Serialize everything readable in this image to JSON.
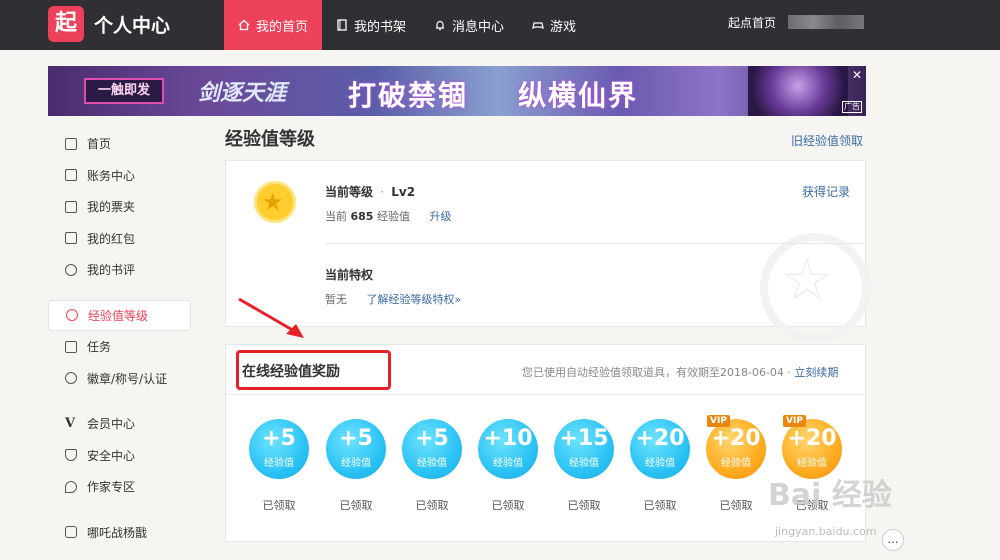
{
  "header": {
    "logo_char": "起",
    "brand": "个人中心",
    "nav": [
      {
        "label": "我的首页",
        "icon": "home-icon",
        "active": true
      },
      {
        "label": "我的书架",
        "icon": "book-icon",
        "active": false
      },
      {
        "label": "消息中心",
        "icon": "bell-icon",
        "active": false
      },
      {
        "label": "游戏",
        "icon": "gamepad-icon",
        "active": false
      }
    ],
    "right_link": "起点首页"
  },
  "banner": {
    "tag": "一触即发",
    "t1": "剑逐天涯",
    "t2": "打破禁锢",
    "t3": "纵横仙界",
    "ad": "广告",
    "close": "✕"
  },
  "sidebar": {
    "items": [
      {
        "label": "首页",
        "icon": "home-icon"
      },
      {
        "label": "账务中心",
        "icon": "document-icon"
      },
      {
        "label": "我的票夹",
        "icon": "ticket-icon"
      },
      {
        "label": "我的红包",
        "icon": "red-packet-icon"
      },
      {
        "label": "我的书评",
        "icon": "comment-icon"
      },
      {
        "label": "经验值等级",
        "icon": "level-icon",
        "active": true
      },
      {
        "label": "任务",
        "icon": "task-icon"
      },
      {
        "label": "徽章/称号/认证",
        "icon": "badge-icon"
      },
      {
        "label": "会员中心",
        "icon": "vip-icon"
      },
      {
        "label": "安全中心",
        "icon": "shield-icon"
      },
      {
        "label": "作家专区",
        "icon": "pen-icon"
      },
      {
        "label": "哪吒战杨戬",
        "icon": "gamepad-icon"
      }
    ]
  },
  "main": {
    "title": "经验值等级",
    "old_link": "旧经验值领取",
    "level": {
      "label": "当前等级",
      "dot": "·",
      "value": "Lv2",
      "current_prefix": "当前",
      "points": "685",
      "points_unit": "经验值",
      "upgrade": "升级",
      "record_link": "获得记录"
    },
    "privilege": {
      "label": "当前特权",
      "value": "暂无",
      "link": "了解经验等级特权»"
    },
    "online": {
      "title": "在线经验值奖励",
      "note": "您已使用自动经验值领取道具，有效期至2018-06-04 · ",
      "renew": "立刻续期",
      "rewards": [
        {
          "amount": "+5",
          "unit": "经验值",
          "status": "已领取",
          "vip": false
        },
        {
          "amount": "+5",
          "unit": "经验值",
          "status": "已领取",
          "vip": false
        },
        {
          "amount": "+5",
          "unit": "经验值",
          "status": "已领取",
          "vip": false
        },
        {
          "amount": "+10",
          "unit": "经验值",
          "status": "已领取",
          "vip": false
        },
        {
          "amount": "+15",
          "unit": "经验值",
          "status": "已领取",
          "vip": false
        },
        {
          "amount": "+20",
          "unit": "经验值",
          "status": "已领取",
          "vip": false
        },
        {
          "amount": "+20",
          "unit": "经验值",
          "status": "已领取",
          "vip": true,
          "vip_label": "VIP"
        },
        {
          "amount": "+20",
          "unit": "经验值",
          "status": "已领取",
          "vip": true,
          "vip_label": "VIP"
        }
      ]
    }
  },
  "watermark": {
    "line1": "Bai 经验",
    "line2": "jingyan.baidu.com"
  },
  "colors": {
    "accent": "#ed4259",
    "topbar": "#302f34",
    "link": "#3b6aa5",
    "highlight": "#e8202a"
  }
}
